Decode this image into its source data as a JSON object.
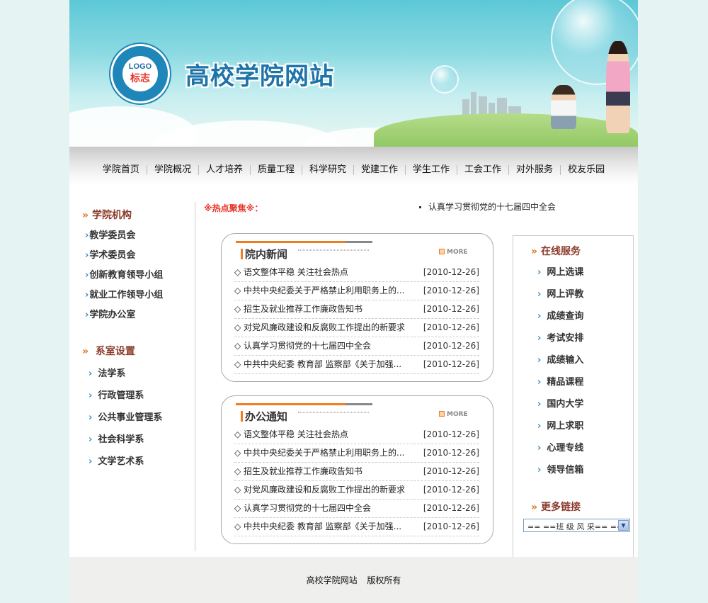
{
  "header": {
    "site_title": "高校学院网站",
    "logo_text": "LOGO",
    "logo_sub": "标志"
  },
  "nav": [
    "学院首页",
    "学院概况",
    "人才培养",
    "质量工程",
    "科学研究",
    "党建工作",
    "学生工作",
    "工会工作",
    "对外服务",
    "校友乐园"
  ],
  "left": {
    "org_title": "学院机构",
    "org_items": [
      "教学委员会",
      "学术委员会",
      "创新教育领导小组",
      "就业工作领导小组",
      "学院办公室"
    ],
    "dept_title": "系室设置",
    "dept_items": [
      "法学系",
      "行政管理系",
      "公共事业管理系",
      "社会科学系",
      "文学艺术系"
    ]
  },
  "hot": {
    "label": "※热点聚焦※：",
    "text": "认真学习贯彻党的十七届四中全会"
  },
  "news_box": {
    "title": "院内新闻",
    "more": "MORE",
    "items": [
      {
        "title": "◇ 语文整体平稳 关注社会热点",
        "date": "[2010-12-26]"
      },
      {
        "title": "◇ 中共中央纪委关于严格禁止利用职务上的...",
        "date": "[2010-12-26]"
      },
      {
        "title": "◇ 招生及就业推荐工作廉政告知书",
        "date": "[2010-12-26]"
      },
      {
        "title": "◇ 对党风廉政建设和反腐败工作提出的新要求",
        "date": "[2010-12-26]"
      },
      {
        "title": "◇ 认真学习贯彻党的十七届四中全会",
        "date": "[2010-12-26]"
      },
      {
        "title": "◇ 中共中央纪委 教育部 监察部《关于加强...",
        "date": "[2010-12-26]"
      }
    ]
  },
  "notice_box": {
    "title": "办公通知",
    "more": "MORE",
    "items": [
      {
        "title": "◇ 语文整体平稳 关注社会热点",
        "date": "[2010-12-26]"
      },
      {
        "title": "◇ 中共中央纪委关于严格禁止利用职务上的...",
        "date": "[2010-12-26]"
      },
      {
        "title": "◇ 招生及就业推荐工作廉政告知书",
        "date": "[2010-12-26]"
      },
      {
        "title": "◇ 对党风廉政建设和反腐败工作提出的新要求",
        "date": "[2010-12-26]"
      },
      {
        "title": "◇ 认真学习贯彻党的十七届四中全会",
        "date": "[2010-12-26]"
      },
      {
        "title": "◇ 中共中央纪委 教育部 监察部《关于加强...",
        "date": "[2010-12-26]"
      }
    ]
  },
  "right": {
    "service_title": "在线服务",
    "service_items": [
      "网上选课",
      "网上评教",
      "成绩查询",
      "考试安排",
      "成绩输入",
      "精品课程",
      "国内大学",
      "网上求职",
      "心理专线",
      "领导信箱"
    ],
    "links_title": "更多链接",
    "select_value": "== ==班 级 风 采== =="
  },
  "footer": {
    "site": "高校学院网站",
    "rights": "版权所有"
  },
  "colors": {
    "accent_orange": "#f07c20",
    "title_brown": "#8b3a2a",
    "hot_red": "#e8352a",
    "chevron_blue": "#2f8fc8"
  }
}
